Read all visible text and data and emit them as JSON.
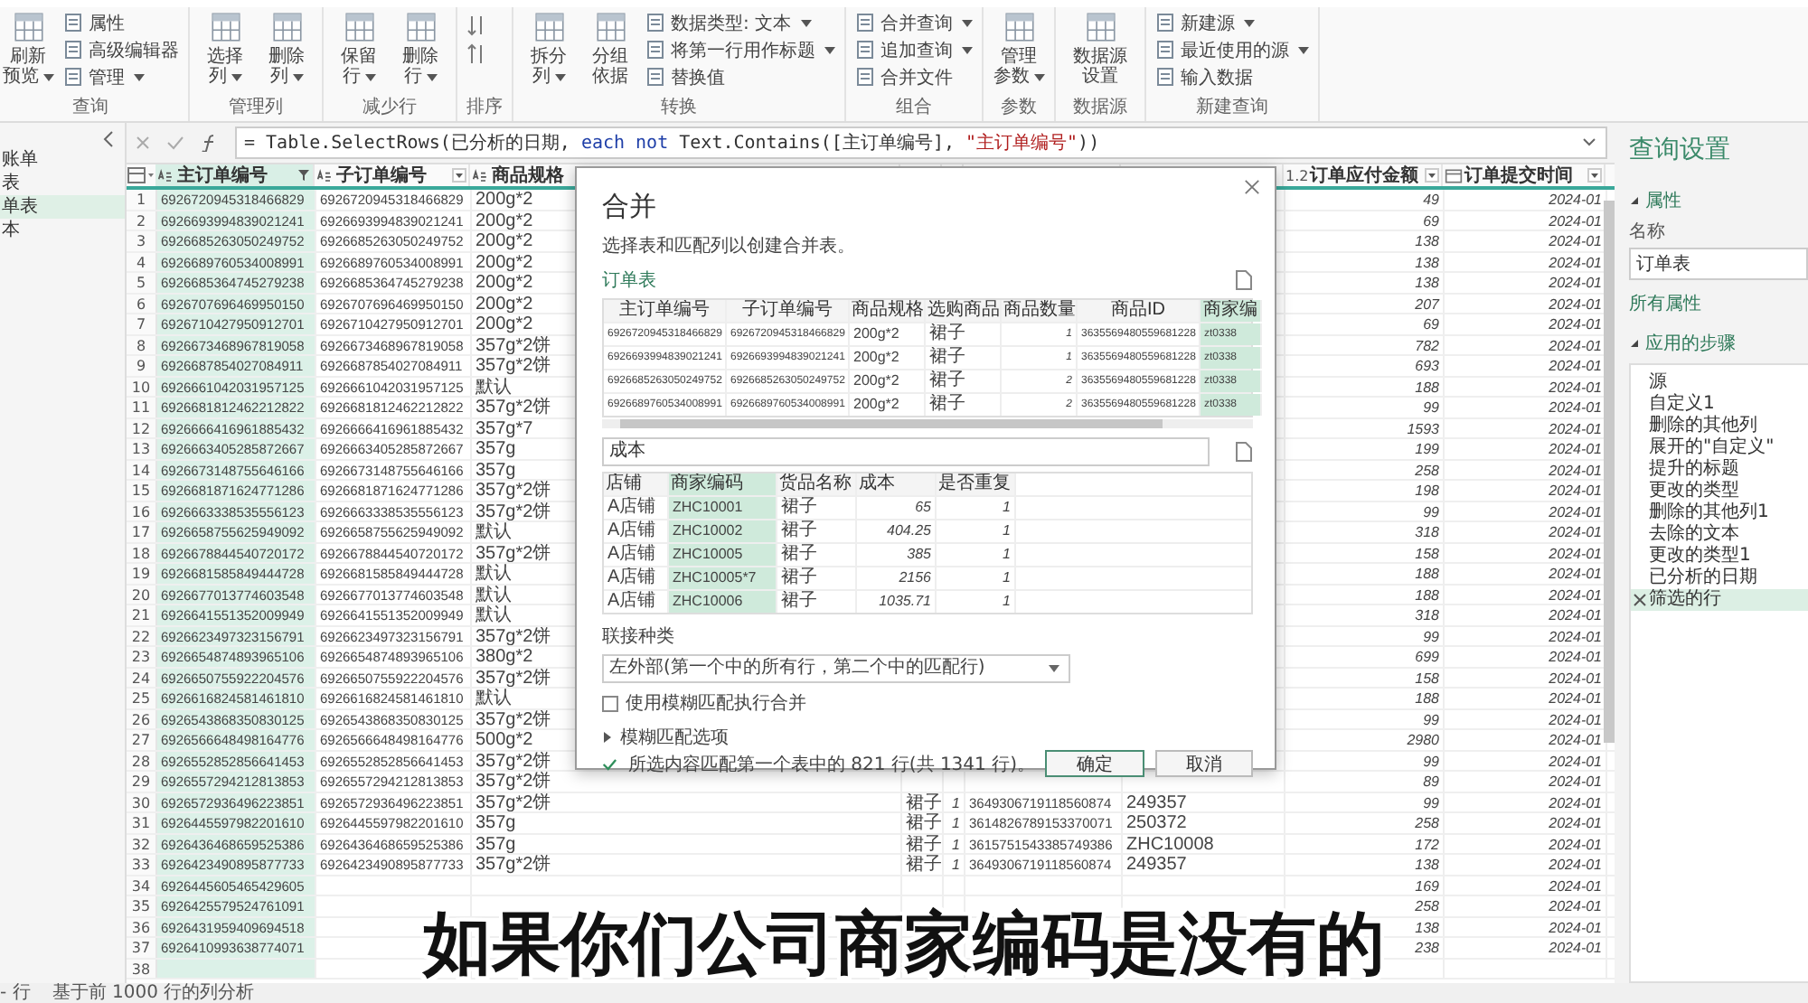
{
  "ribbon": {
    "groups": [
      {
        "label": "查询",
        "buttons": [
          {
            "label": "刷新预览",
            "kind": "large",
            "dropdown": true
          },
          {
            "label": "属性",
            "kind": "small",
            "dropdown": false
          },
          {
            "label": "高级编辑器",
            "kind": "small",
            "dropdown": false
          },
          {
            "label": "管理",
            "kind": "small",
            "dropdown": true
          }
        ]
      },
      {
        "label": "管理列",
        "buttons": [
          {
            "label": "选择列",
            "kind": "large",
            "dropdown": true
          },
          {
            "label": "删除列",
            "kind": "large",
            "dropdown": true
          }
        ]
      },
      {
        "label": "减少行",
        "buttons": [
          {
            "label": "保留行",
            "kind": "large",
            "dropdown": true
          },
          {
            "label": "删除行",
            "kind": "large",
            "dropdown": true
          }
        ]
      },
      {
        "label": "排序",
        "buttons": [
          {
            "kind": "sort"
          }
        ]
      },
      {
        "label": "转换",
        "buttons": [
          {
            "label": "拆分列",
            "kind": "large",
            "dropdown": true
          },
          {
            "label": "分组依据",
            "kind": "large",
            "dropdown": false
          },
          {
            "label": "数据类型: 文本",
            "kind": "small",
            "dropdown": true
          },
          {
            "label": "将第一行用作标题",
            "kind": "small",
            "dropdown": true
          },
          {
            "label": "替换值",
            "kind": "small",
            "dropdown": false
          }
        ]
      },
      {
        "label": "组合",
        "buttons": [
          {
            "label": "合并查询",
            "kind": "small",
            "dropdown": true
          },
          {
            "label": "追加查询",
            "kind": "small",
            "dropdown": true
          },
          {
            "label": "合并文件",
            "kind": "small",
            "dropdown": false
          }
        ]
      },
      {
        "label": "参数",
        "buttons": [
          {
            "label": "管理参数",
            "kind": "large",
            "dropdown": true
          }
        ]
      },
      {
        "label": "数据源",
        "buttons": [
          {
            "label": "数据源设置",
            "kind": "large",
            "dropdown": false
          }
        ]
      },
      {
        "label": "新建查询",
        "buttons": [
          {
            "label": "新建源",
            "kind": "small",
            "dropdown": true
          },
          {
            "label": "最近使用的源",
            "kind": "small",
            "dropdown": true
          },
          {
            "label": "输入数据",
            "kind": "small",
            "dropdown": false
          }
        ]
      }
    ]
  },
  "queries": {
    "items": [
      {
        "label": "账单",
        "selected": false
      },
      {
        "label": "表",
        "selected": false
      },
      {
        "label": "单表",
        "selected": true
      },
      {
        "label": "本",
        "selected": false
      }
    ]
  },
  "formula": [
    {
      "kind": "code",
      "text": "= Table.SelectRows(已分析的日期, "
    },
    {
      "kind": "keyword",
      "text": "each not"
    },
    {
      "kind": "code",
      "text": " Text.Contains([主订单编号], "
    },
    {
      "kind": "string",
      "text": "\"主订单编号\""
    },
    {
      "kind": "code",
      "text": "))"
    }
  ],
  "grid": {
    "columns": [
      {
        "label": "主订单编号",
        "kind": "text",
        "selected": true,
        "filtered": true
      },
      {
        "label": "子订单编号",
        "kind": "text",
        "selected": false,
        "filtered": false
      },
      {
        "label": "商品规格",
        "kind": "text",
        "selected": false
      },
      {
        "label": "订单应付金额",
        "kind": "number",
        "type_mark": "1.2",
        "selected": false,
        "filtered": false
      },
      {
        "label": "订单提交时间",
        "kind": "date",
        "selected": false,
        "filtered": false
      }
    ],
    "rows": [
      {
        "n": "1",
        "main": "6926720945318466829",
        "sub": "6926720945318466829",
        "spec": "200g*2",
        "amount": "49",
        "date": "2024-01"
      },
      {
        "n": "2",
        "main": "6926693994839021241",
        "sub": "6926693994839021241",
        "spec": "200g*2",
        "amount": "69",
        "date": "2024-01"
      },
      {
        "n": "3",
        "main": "6926685263050249752",
        "sub": "6926685263050249752",
        "spec": "200g*2",
        "amount": "138",
        "date": "2024-01"
      },
      {
        "n": "4",
        "main": "6926689760534008991",
        "sub": "6926689760534008991",
        "spec": "200g*2",
        "amount": "138",
        "date": "2024-01"
      },
      {
        "n": "5",
        "main": "6926685364745279238",
        "sub": "6926685364745279238",
        "spec": "200g*2",
        "amount": "138",
        "date": "2024-01"
      },
      {
        "n": "6",
        "main": "6926707696469950150",
        "sub": "6926707696469950150",
        "spec": "200g*2",
        "amount": "207",
        "date": "2024-01"
      },
      {
        "n": "7",
        "main": "6926710427950912701",
        "sub": "6926710427950912701",
        "spec": "200g*2",
        "amount": "69",
        "date": "2024-01"
      },
      {
        "n": "8",
        "main": "6926673468967819058",
        "sub": "6926673468967819058",
        "spec": "357g*2饼",
        "amount": "782",
        "date": "2024-01"
      },
      {
        "n": "9",
        "main": "6926687854027084911",
        "sub": "6926687854027084911",
        "spec": "357g*2饼",
        "amount": "693",
        "date": "2024-01"
      },
      {
        "n": "10",
        "main": "6926661042031957125",
        "sub": "6926661042031957125",
        "spec": "默认",
        "amount": "188",
        "date": "2024-01"
      },
      {
        "n": "11",
        "main": "6926681812462212822",
        "sub": "6926681812462212822",
        "spec": "357g*2饼",
        "amount": "99",
        "date": "2024-01"
      },
      {
        "n": "12",
        "main": "6926666416961885432",
        "sub": "6926666416961885432",
        "spec": "357g*7",
        "amount": "1593",
        "date": "2024-01"
      },
      {
        "n": "13",
        "main": "6926663405285872667",
        "sub": "6926663405285872667",
        "spec": "357g",
        "amount": "199",
        "date": "2024-01"
      },
      {
        "n": "14",
        "main": "6926673148755646166",
        "sub": "6926673148755646166",
        "spec": "357g",
        "amount": "258",
        "date": "2024-01"
      },
      {
        "n": "15",
        "main": "6926681871624771286",
        "sub": "6926681871624771286",
        "spec": "357g*2饼",
        "amount": "198",
        "date": "2024-01"
      },
      {
        "n": "16",
        "main": "6926663338535556123",
        "sub": "6926663338535556123",
        "spec": "357g*2饼",
        "amount": "99",
        "date": "2024-01"
      },
      {
        "n": "17",
        "main": "6926658755625949092",
        "sub": "6926658755625949092",
        "spec": "默认",
        "amount": "318",
        "date": "2024-01"
      },
      {
        "n": "18",
        "main": "6926678844540720172",
        "sub": "6926678844540720172",
        "spec": "357g*2饼",
        "amount": "158",
        "date": "2024-01"
      },
      {
        "n": "19",
        "main": "6926681585849444728",
        "sub": "6926681585849444728",
        "spec": "默认",
        "amount": "188",
        "date": "2024-01"
      },
      {
        "n": "20",
        "main": "6926677013774603548",
        "sub": "6926677013774603548",
        "spec": "默认",
        "amount": "188",
        "date": "2024-01"
      },
      {
        "n": "21",
        "main": "6926641551352009949",
        "sub": "6926641551352009949",
        "spec": "默认",
        "amount": "318",
        "date": "2024-01"
      },
      {
        "n": "22",
        "main": "6926623497323156791",
        "sub": "6926623497323156791",
        "spec": "357g*2饼",
        "amount": "99",
        "date": "2024-01"
      },
      {
        "n": "23",
        "main": "6926654874893965106",
        "sub": "6926654874893965106",
        "spec": "380g*2",
        "amount": "699",
        "date": "2024-01"
      },
      {
        "n": "24",
        "main": "6926650755922204576",
        "sub": "6926650755922204576",
        "spec": "357g*2饼",
        "amount": "158",
        "date": "2024-01"
      },
      {
        "n": "25",
        "main": "6926616824581461810",
        "sub": "6926616824581461810",
        "spec": "默认",
        "amount": "188",
        "date": "2024-01"
      },
      {
        "n": "26",
        "main": "6926543868350830125",
        "sub": "6926543868350830125",
        "spec": "357g*2饼",
        "amount": "99",
        "date": "2024-01"
      },
      {
        "n": "27",
        "main": "6926566648498164776",
        "sub": "6926566648498164776",
        "spec": "500g*2",
        "amount": "2980",
        "date": "2024-01"
      },
      {
        "n": "28",
        "main": "6926552852856641453",
        "sub": "6926552852856641453",
        "spec": "357g*2饼",
        "amount": "99",
        "date": "2024-01"
      },
      {
        "n": "29",
        "main": "6926557294212813853",
        "sub": "6926557294212813853",
        "spec": "357g*2饼",
        "amount": "89",
        "date": "2024-01"
      },
      {
        "n": "30",
        "main": "6926572936496223851",
        "sub": "6926572936496223851",
        "spec": "357g*2饼",
        "product": "裙子",
        "qty": "1",
        "pid": "3649306719118560874",
        "code": "249357",
        "amount": "99",
        "date": "2024-01"
      },
      {
        "n": "31",
        "main": "6926445597982201610",
        "sub": "6926445597982201610",
        "spec": "357g",
        "product": "裙子",
        "qty": "1",
        "pid": "3614826789153370071",
        "code": "250372",
        "amount": "258",
        "date": "2024-01"
      },
      {
        "n": "32",
        "main": "6926436468659525386",
        "sub": "6926436468659525386",
        "spec": "357g",
        "product": "裙子",
        "qty": "1",
        "pid": "3615751543385749386",
        "code": "ZHC10008",
        "amount": "172",
        "date": "2024-01"
      },
      {
        "n": "33",
        "main": "6926423490895877733",
        "sub": "6926423490895877733",
        "spec": "357g*2饼",
        "product": "裙子",
        "qty": "1",
        "pid": "3649306719118560874",
        "code": "249357",
        "amount": "138",
        "date": "2024-01"
      },
      {
        "n": "34",
        "main": "6926445605465429605",
        "amount": "169",
        "date": "2024-01"
      },
      {
        "n": "35",
        "main": "6926425579524761091",
        "amount": "258",
        "date": "2024-01"
      },
      {
        "n": "36",
        "main": "6926431959409694518",
        "amount": "138",
        "date": "2024-01"
      },
      {
        "n": "37",
        "main": "6926410993638774071",
        "amount": "238",
        "date": "2024-01"
      },
      {
        "n": "38"
      }
    ]
  },
  "settings": {
    "title": "查询设置",
    "properties": {
      "label": "属性",
      "expanded": true
    },
    "name_label": "名称",
    "name_value": "订单表",
    "all_properties": "所有属性",
    "steps_section": {
      "label": "应用的步骤",
      "expanded": true
    },
    "steps": [
      {
        "label": "源",
        "selected": false
      },
      {
        "label": "自定义1",
        "selected": false
      },
      {
        "label": "删除的其他列",
        "selected": false
      },
      {
        "label": "展开的\"自定义\"",
        "selected": false
      },
      {
        "label": "提升的标题",
        "selected": false
      },
      {
        "label": "更改的类型",
        "selected": false
      },
      {
        "label": "删除的其他列1",
        "selected": false
      },
      {
        "label": "去除的文本",
        "selected": false
      },
      {
        "label": "更改的类型1",
        "selected": false
      },
      {
        "label": "已分析的日期",
        "selected": false
      },
      {
        "label": "筛选的行",
        "selected": true
      }
    ]
  },
  "status_bar": {
    "rows": "- 行",
    "profiling": "基于前 1000 行的列分析"
  },
  "dialog": {
    "title": "合并",
    "description": "选择表和匹配列以创建合并表。",
    "first_table": {
      "label": "订单表",
      "columns": [
        {
          "label": "主订单编号",
          "kind": "text",
          "selected": false
        },
        {
          "label": "子订单编号",
          "kind": "text",
          "selected": false
        },
        {
          "label": "商品规格",
          "kind": "text",
          "selected": false
        },
        {
          "label": "选购商品",
          "kind": "text",
          "selected": false
        },
        {
          "label": "商品数量",
          "kind": "number",
          "selected": false
        },
        {
          "label": "商品ID",
          "kind": "text",
          "selected": false
        },
        {
          "label": "商家编",
          "kind": "text",
          "selected": true
        }
      ],
      "rows": [
        [
          "6926720945318466829",
          "6926720945318466829",
          "200g*2",
          "裙子",
          "1",
          "3635569480559681228",
          "zt0338"
        ],
        [
          "6926693994839021241",
          "6926693994839021241",
          "200g*2",
          "裙子",
          "1",
          "3635569480559681228",
          "zt0338"
        ],
        [
          "6926685263050249752",
          "6926685263050249752",
          "200g*2",
          "裙子",
          "2",
          "3635569480559681228",
          "zt0338"
        ],
        [
          "6926689760534008991",
          "6926689760534008991",
          "200g*2",
          "裙子",
          "2",
          "3635569480559681228",
          "zt0338"
        ]
      ]
    },
    "second_table": {
      "selector": "成本",
      "columns": [
        {
          "label": "店铺",
          "kind": "text",
          "selected": false
        },
        {
          "label": "商家编码",
          "kind": "text",
          "selected": true
        },
        {
          "label": "货品名称",
          "kind": "text",
          "selected": false
        },
        {
          "label": "成本",
          "kind": "number",
          "selected": false
        },
        {
          "label": "是否重复",
          "kind": "number",
          "selected": false
        }
      ],
      "rows": [
        [
          "A店铺",
          "ZHC10001",
          "裙子",
          "65",
          "1"
        ],
        [
          "A店铺",
          "ZHC10002",
          "裙子",
          "404.25",
          "1"
        ],
        [
          "A店铺",
          "ZHC10005",
          "裙子",
          "385",
          "1"
        ],
        [
          "A店铺",
          "ZHC10005*7",
          "裙子",
          "2156",
          "1"
        ],
        [
          "A店铺",
          "ZHC10006",
          "裙子",
          "1035.71",
          "1"
        ]
      ]
    },
    "join_label": "联接种类",
    "join_kind": "左外部(第一个中的所有行，第二个中的匹配行)",
    "fuzzy": {
      "label": "使用模糊匹配执行合并",
      "checked": false
    },
    "fuzzy_options": {
      "label": "模糊匹配选项",
      "expanded": false
    },
    "match_status": "所选内容匹配第一个表中的 821 行(共 1341 行)。",
    "buttons": [
      {
        "label": "确定",
        "primary": true
      },
      {
        "label": "取消",
        "primary": false
      }
    ]
  },
  "subtitle": "如果你们公司商家编码是没有的"
}
